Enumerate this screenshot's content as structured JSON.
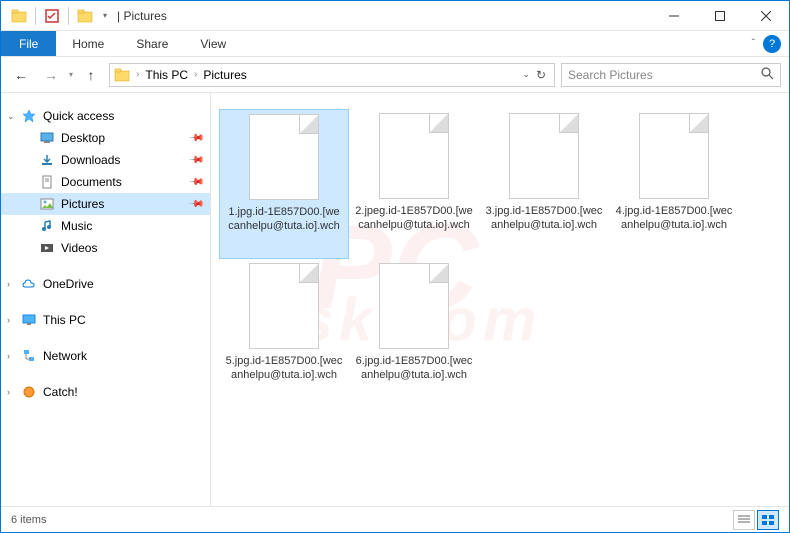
{
  "titlebar": {
    "title": "Pictures"
  },
  "ribbon": {
    "file": "File",
    "tabs": [
      "Home",
      "Share",
      "View"
    ]
  },
  "nav": {
    "breadcrumb": [
      "This PC",
      "Pictures"
    ],
    "search_placeholder": "Search Pictures"
  },
  "sidebar": {
    "quick_access": "Quick access",
    "qa_items": [
      {
        "label": "Desktop",
        "pinned": true
      },
      {
        "label": "Downloads",
        "pinned": true
      },
      {
        "label": "Documents",
        "pinned": true
      },
      {
        "label": "Pictures",
        "pinned": true,
        "selected": true
      },
      {
        "label": "Music",
        "pinned": false
      },
      {
        "label": "Videos",
        "pinned": false
      }
    ],
    "onedrive": "OneDrive",
    "this_pc": "This PC",
    "network": "Network",
    "catch": "Catch!"
  },
  "files": [
    {
      "name": "1.jpg.id-1E857D00.[wecanhelpu@tuta.io].wch",
      "selected": true
    },
    {
      "name": "2.jpeg.id-1E857D00.[wecanhelpu@tuta.io].wch",
      "selected": false
    },
    {
      "name": "3.jpg.id-1E857D00.[wecanhelpu@tuta.io].wch",
      "selected": false
    },
    {
      "name": "4.jpg.id-1E857D00.[wecanhelpu@tuta.io].wch",
      "selected": false
    },
    {
      "name": "5.jpg.id-1E857D00.[wecanhelpu@tuta.io].wch",
      "selected": false
    },
    {
      "name": "6.jpg.id-1E857D00.[wecanhelpu@tuta.io].wch",
      "selected": false
    }
  ],
  "status": {
    "count": "6 items"
  }
}
